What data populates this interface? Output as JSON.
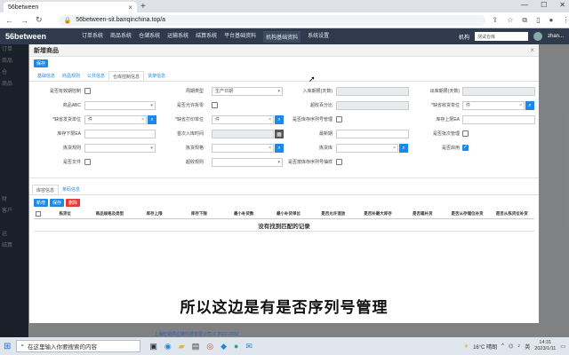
{
  "browser": {
    "tab_title": "56between",
    "url": "56between-sit.banqinchina.top/a"
  },
  "app": {
    "logo": "56between",
    "nav": [
      "订单系统",
      "商品系统",
      "仓储系统",
      "运输系统",
      "结算系统",
      "平台基础资料",
      "机构基础资料",
      "系统设置"
    ],
    "active_nav": "机构基础资料",
    "org_label": "机构",
    "warehouse_placeholder": "测试仓库",
    "user": "zhan..."
  },
  "sidebar": [
    "订单",
    "商品",
    "仓",
    "商品",
    "",
    "",
    "",
    "",
    "",
    "",
    "",
    "",
    "",
    "财",
    "客户",
    "",
    "运",
    "结算"
  ],
  "modal": {
    "title": "新增商品",
    "save_label": "保存",
    "tabs": [
      "基础信息",
      "商品规则",
      "公共信息",
      "仓库控制信息",
      "货架信息"
    ],
    "active_tab": "仓库控制信息"
  },
  "form": {
    "row1": {
      "l1": "是否有效期控制",
      "l2": "周期类型",
      "v2": "生产日期",
      "l3": "入库期限(天数)",
      "l4": "出库期限(天数)"
    },
    "row2": {
      "l1": "商品ABC",
      "l2": "是否允许拆零",
      "l3": "超收百分比",
      "l4": "*缺省收货单位",
      "v4": "件"
    },
    "row3": {
      "l1": "*缺省发货单位",
      "v1": "件",
      "l2": "*缺省打印单位",
      "v2": "件",
      "l3": "是否库存序列号管理",
      "l4": "库存上限EA"
    },
    "row4": {
      "l1": "库存下限EA",
      "l2": "首次入库时间",
      "l3": "最新期",
      "l4": "是否批次管理"
    },
    "row5": {
      "l1": "拣货规则",
      "l2": "拣货规格",
      "l3": "拣货库",
      "l4": "是否启用"
    },
    "row6": {
      "l1": "是否文件",
      "l2": "超收规则",
      "l3": "是否按库存序列号抽样"
    }
  },
  "subtabs": [
    "库容信息",
    "条码信息"
  ],
  "sub_buttons": {
    "add": "新增",
    "copy": "保存",
    "delete": "删除"
  },
  "table": {
    "headers": [
      "拣货位",
      "商品规格及类型",
      "库存上限",
      "库存下限",
      "最小补货数",
      "最小补货单位",
      "是否允许混放",
      "是否补最大库存",
      "是否箱补货",
      "是否从存储位补货",
      "是否从拣货位补货"
    ],
    "empty": "没有找到匹配的记录"
  },
  "subtitle": "所以这边是有是否序列号管理",
  "footer": "上海旺销供应链科技有限公司 © 2022-2032",
  "taskbar": {
    "search_placeholder": "在这里输入你要搜索的内容",
    "weather": "16°C 晴朗",
    "time": "14:31",
    "date": "2023/1/11",
    "lang": "英"
  }
}
